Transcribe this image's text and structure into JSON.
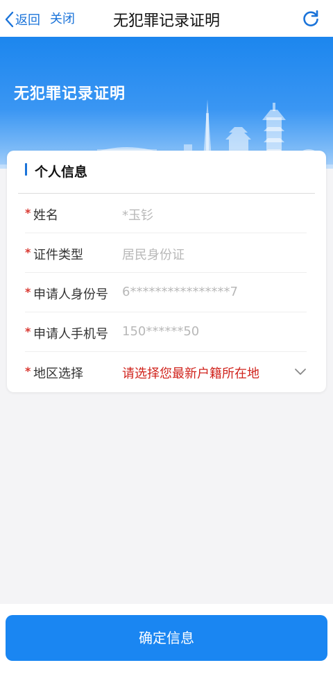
{
  "nav": {
    "back_label": "返回",
    "close_label": "关闭",
    "title": "无犯罪记录证明",
    "refresh_icon": "refresh-icon"
  },
  "banner": {
    "title": "无犯罪记录证明"
  },
  "card": {
    "title": "个人信息",
    "fields": [
      {
        "label": "姓名",
        "value": "*玉钐",
        "required": true
      },
      {
        "label": "证件类型",
        "value": "居民身份证",
        "required": true
      },
      {
        "label": "申请人身份号",
        "value": "6****************7",
        "required": true
      },
      {
        "label": "申请人手机号",
        "value": "150******50",
        "required": true
      },
      {
        "label": "地区选择",
        "value": "请选择您最新户籍所在地",
        "required": true,
        "type": "select"
      }
    ],
    "required_mark": "*"
  },
  "footer": {
    "confirm_label": "确定信息"
  },
  "colors": {
    "accent": "#1a73d9",
    "button": "#1a86f2",
    "required": "#d9362f",
    "select_prompt": "#d0231c"
  }
}
